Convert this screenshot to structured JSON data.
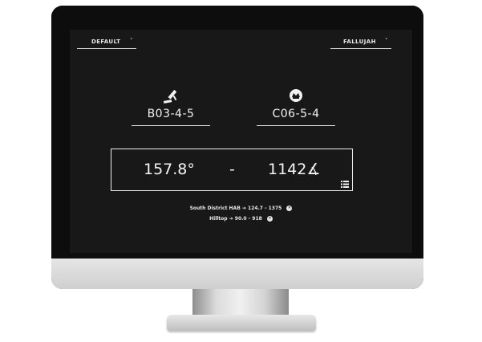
{
  "header": {
    "left_selector": {
      "label": "DEFAULT",
      "caret": "˅"
    },
    "right_selector": {
      "label": "FALLUJAH",
      "caret": "˅"
    }
  },
  "units": {
    "mortar": {
      "icon": "mortar-icon",
      "code": "B03-4-5"
    },
    "target": {
      "icon": "target-marker-icon",
      "code": "C06-5-4"
    }
  },
  "result": {
    "angle": "157.8°",
    "separator": "-",
    "distance": "1142∡",
    "list_icon": "list-icon"
  },
  "history": [
    {
      "text": "South District HAB ➜ 124.7 - 1375",
      "close": "✕"
    },
    {
      "text": "Hilltop ➜ 90.0 - 918",
      "close": "✕"
    }
  ]
}
